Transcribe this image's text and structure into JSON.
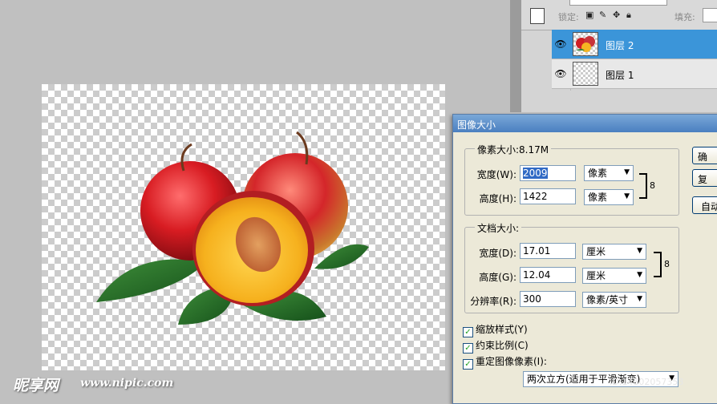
{
  "layers_panel": {
    "lock_label": "锁定:",
    "fill_label": "填充:",
    "layers": [
      {
        "name": "图层 2",
        "active": true
      },
      {
        "name": "图层 1",
        "active": false
      }
    ]
  },
  "dialog": {
    "title": "图像大小",
    "pixel_group": {
      "legend": "像素大小:8.17M",
      "width_label": "宽度(W):",
      "width_label_key": "W",
      "width_value": "2009",
      "width_unit": "像素",
      "height_label": "高度(H):",
      "height_value": "1422",
      "height_unit": "像素"
    },
    "doc_group": {
      "legend": "文档大小:",
      "width_label": "宽度(D):",
      "width_value": "17.01",
      "width_unit": "厘米",
      "height_label": "高度(G):",
      "height_value": "12.04",
      "height_unit": "厘米",
      "resolution_label": "分辨率(R):",
      "resolution_value": "300",
      "resolution_unit": "像素/英寸"
    },
    "checks": [
      {
        "label": "缩放样式(Y)",
        "checked": true
      },
      {
        "label": "约束比例(C)",
        "checked": true
      },
      {
        "label": "重定图像像素(I):",
        "checked": true
      }
    ],
    "resample_method": "两次立方(适用于平滑渐变)",
    "buttons": [
      "确",
      "复",
      "自动"
    ]
  },
  "watermark": {
    "brand": "昵享网",
    "url": "www.nipic.com",
    "id": "ID:14802057353"
  }
}
